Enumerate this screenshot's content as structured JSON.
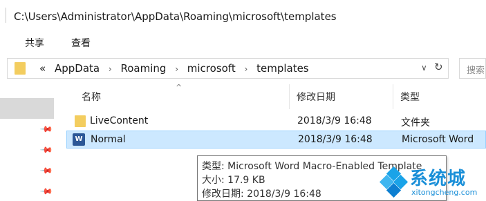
{
  "window": {
    "title": "C:\\Users\\Administrator\\AppData\\Roaming\\microsoft\\templates"
  },
  "ribbon": {
    "tabs": [
      {
        "label": "共享"
      },
      {
        "label": "查看"
      }
    ]
  },
  "address": {
    "prefix": "«",
    "crumbs": [
      "AppData",
      "Roaming",
      "microsoft",
      "templates"
    ],
    "separator": "›",
    "dropdown_glyph": "∨",
    "refresh_glyph": "↻"
  },
  "search": {
    "placeholder": "搜索"
  },
  "columns": {
    "name": "名称",
    "date": "修改日期",
    "type": "类型"
  },
  "files": [
    {
      "name": "LiveContent",
      "date": "2018/3/9 16:48",
      "type": "文件夹",
      "icon": "folder-icon"
    },
    {
      "name": "Normal",
      "date": "2018/3/9 16:48",
      "type": "Microsoft Word",
      "icon": "word-template-icon"
    }
  ],
  "tooltip": {
    "type_line": "类型: Microsoft Word Macro-Enabled Template",
    "size_line": "大小: 17.9 KB",
    "date_line": "修改日期: 2018/3/9 16:48"
  },
  "watermark": {
    "cn": "系统城",
    "en": "xitongcheng.com"
  },
  "colors": {
    "selection": "#cce8ff",
    "folder": "#f3cd5f",
    "word": "#2b5797",
    "watermark": "#1a8fd8"
  }
}
